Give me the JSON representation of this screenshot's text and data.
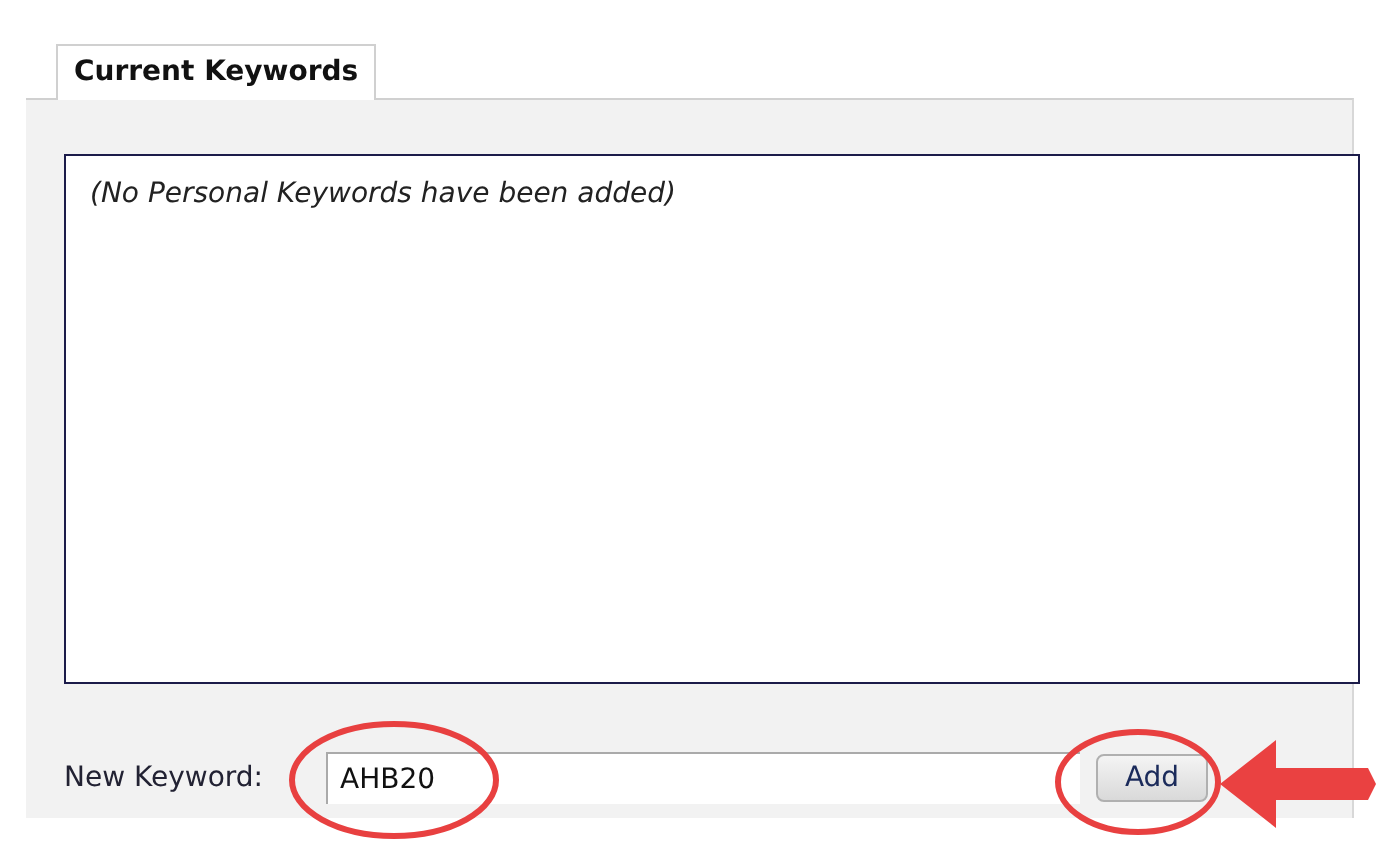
{
  "tabs": [
    {
      "label": "Current Keywords",
      "selected": true
    }
  ],
  "keyword_list": {
    "empty_message": "(No Personal Keywords have been added)"
  },
  "new_keyword": {
    "label": "New Keyword:",
    "value": "AHB20"
  },
  "add_button": "Add"
}
